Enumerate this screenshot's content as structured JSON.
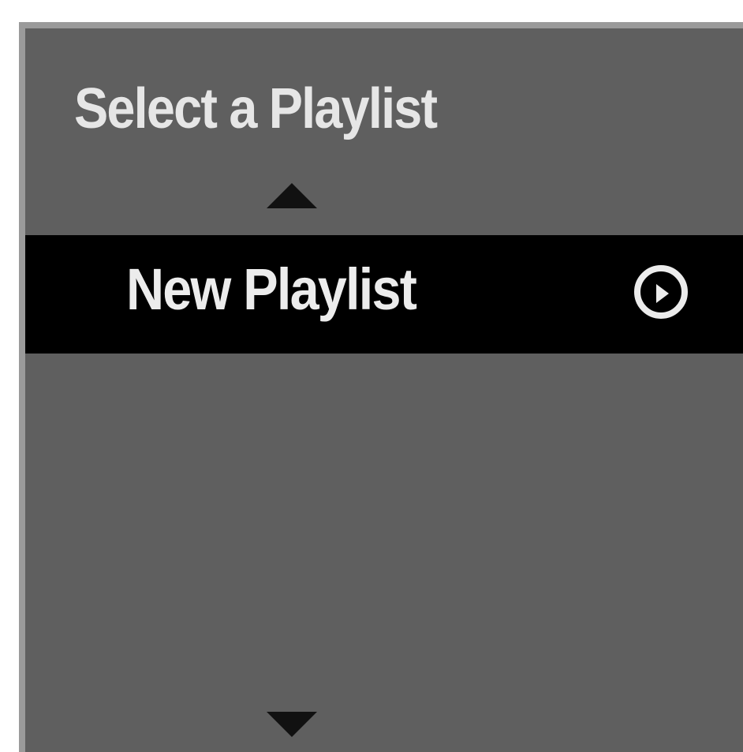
{
  "dialog": {
    "title": "Select a Playlist",
    "playlists": [
      {
        "label": "New Playlist",
        "selected": true,
        "icon": "play-circle-icon"
      }
    ],
    "scroll_up_icon": "arrow-up-icon",
    "scroll_down_icon": "arrow-down-icon"
  },
  "colors": {
    "panel_background": "#5f5f5f",
    "panel_border": "#9a9a9a",
    "selected_row_background": "#000000",
    "text": "#e6e6e6",
    "arrows": "#111111"
  }
}
